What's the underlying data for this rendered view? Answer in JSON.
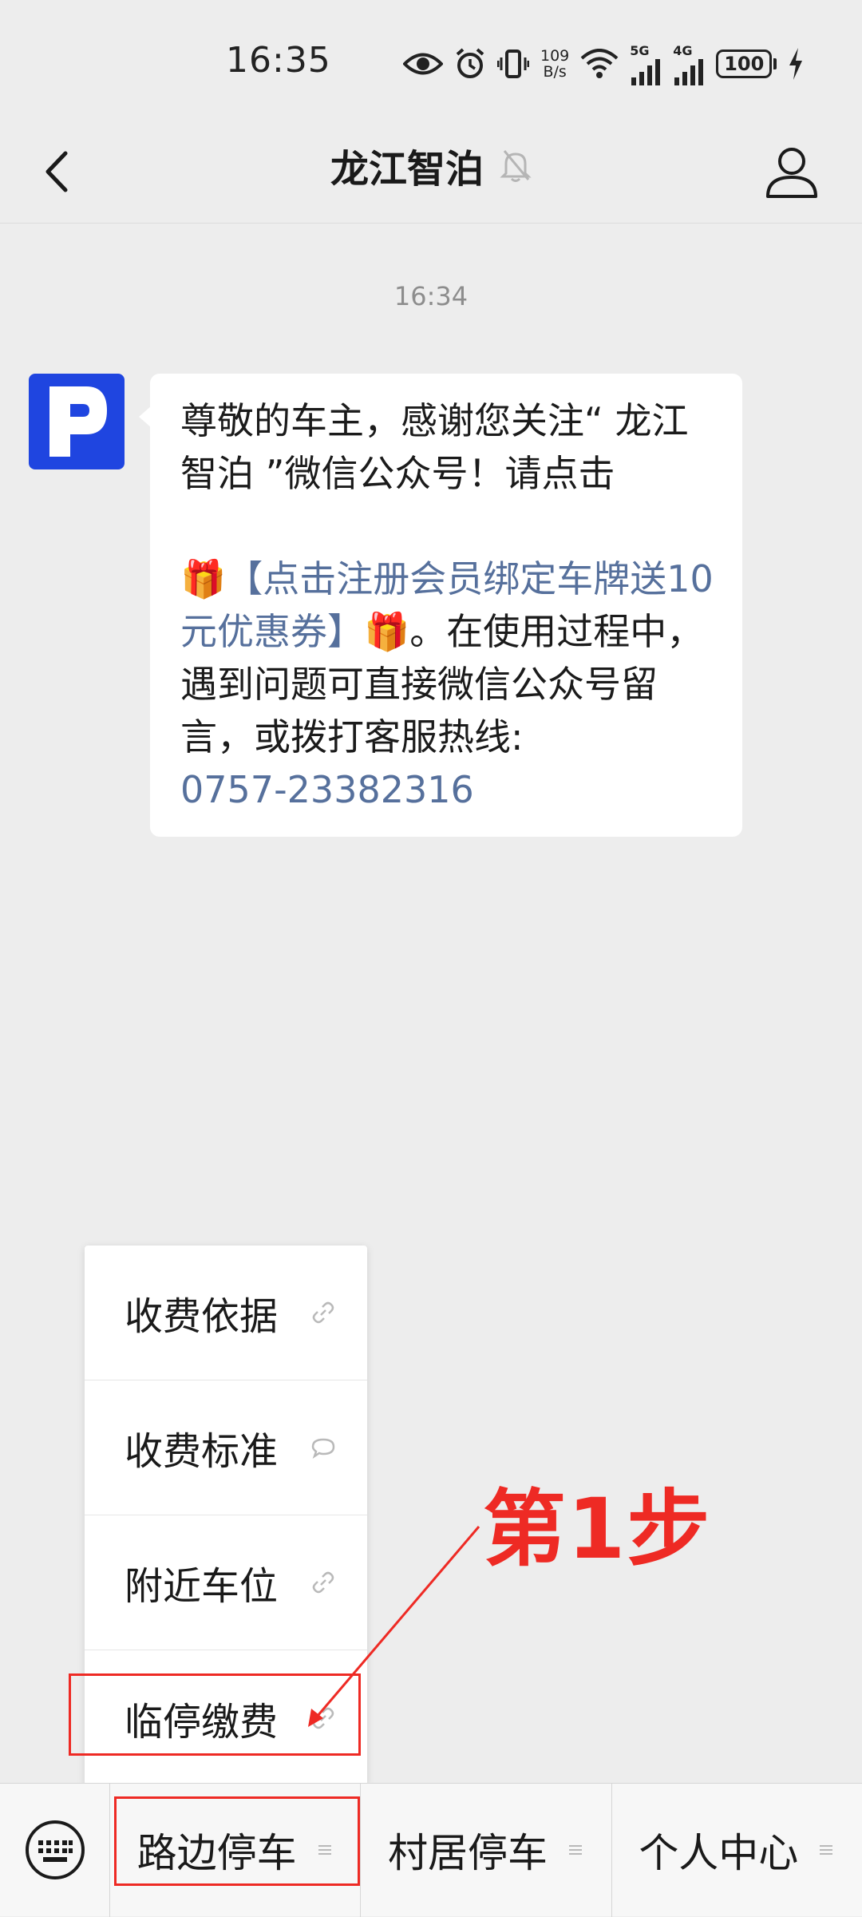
{
  "status_bar": {
    "time": "16:35",
    "net_speed_value": "109",
    "net_speed_unit": "B/s",
    "net_5g": "5G",
    "net_4g": "4G",
    "battery": "100"
  },
  "header": {
    "title": "龙江智泊"
  },
  "chat": {
    "timestamp": "16:34",
    "message": {
      "intro": "尊敬的车主，感谢您关注“ 龙江智泊 ”微信公众号！请点击",
      "gift_emoji": "🎁",
      "link": "【点击注册会员绑定车牌送10元优惠券】",
      "after_link": "。在使用过程中，遇到问题可直接微信公众号留言，或拨打客服热线:",
      "phone": "0757-23382316"
    }
  },
  "popup_menu": {
    "items": [
      {
        "label": "收费依据",
        "icon": "link-icon"
      },
      {
        "label": "收费标准",
        "icon": "message-icon"
      },
      {
        "label": "附近车位",
        "icon": "link-icon"
      },
      {
        "label": "临停缴费",
        "icon": "link-icon"
      }
    ]
  },
  "annotation": {
    "step_label": "第1步",
    "color": "#ee2a24"
  },
  "bottom_bar": {
    "tabs": [
      {
        "label": "路边停车"
      },
      {
        "label": "村居停车"
      },
      {
        "label": "个人中心"
      }
    ]
  },
  "colors": {
    "background": "#ededed",
    "avatar_blue": "#1f45e0",
    "link_blue": "#56709c"
  }
}
